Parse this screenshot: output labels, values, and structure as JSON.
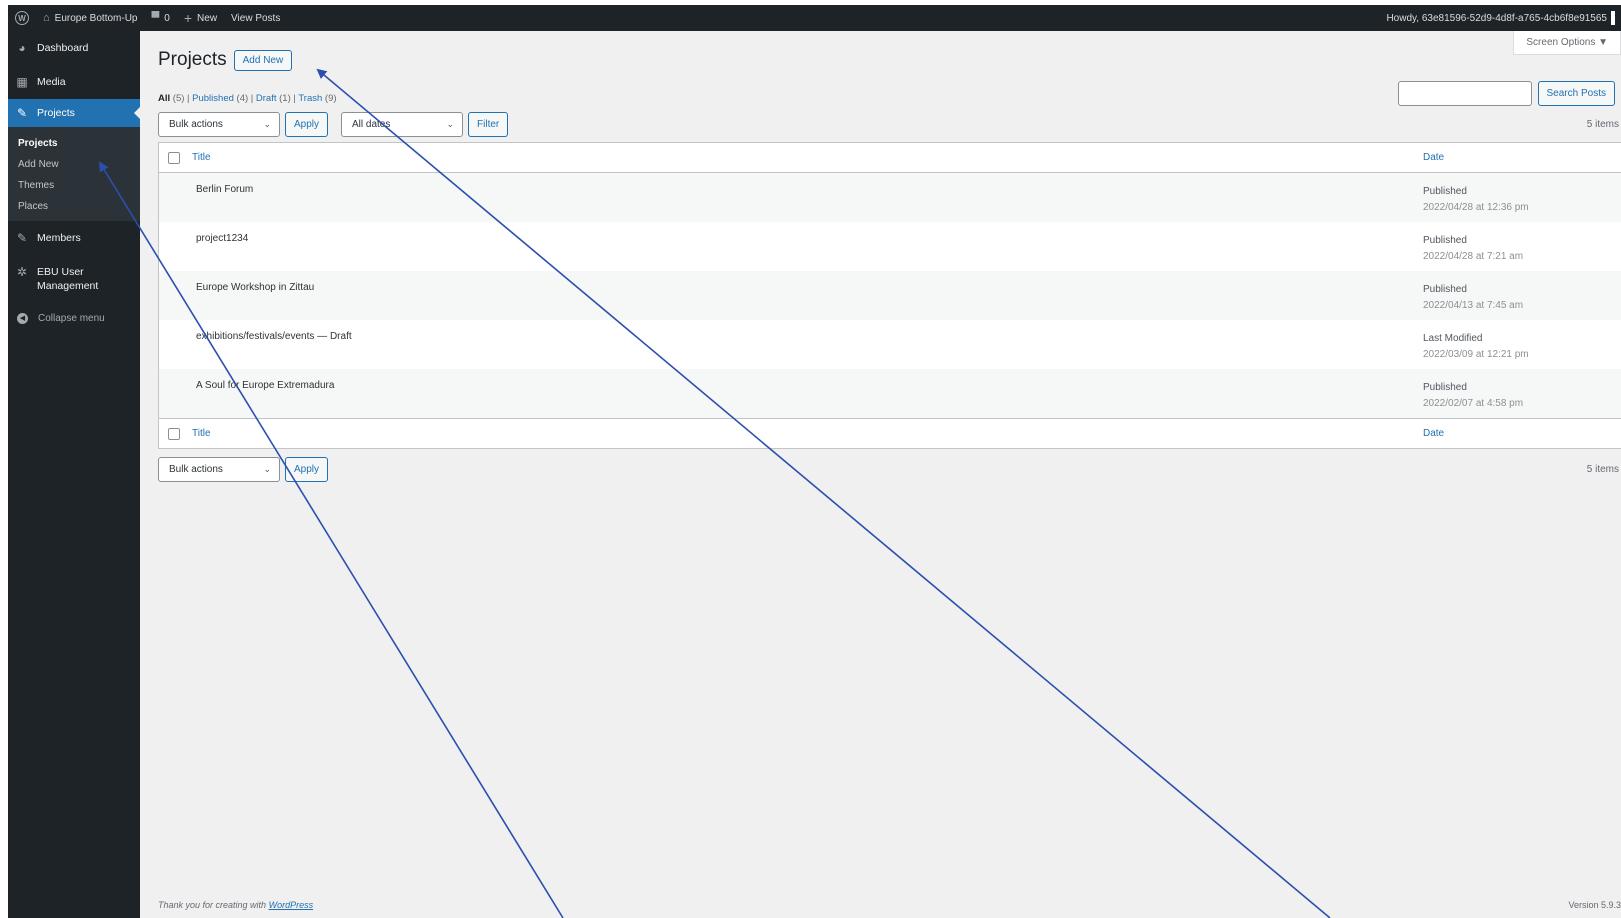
{
  "admin_bar": {
    "site_name": "Europe Bottom-Up",
    "comments_count": "0",
    "new_label": "New",
    "view_posts_label": "View Posts",
    "howdy_text": "Howdy, 63e81596-52d9-4d8f-a765-4cb6f8e91565"
  },
  "sidebar": {
    "dashboard": "Dashboard",
    "media": "Media",
    "projects": "Projects",
    "submenu": [
      "Projects",
      "Add New",
      "Themes",
      "Places"
    ],
    "members": "Members",
    "ebu_user_management": [
      "EBU User",
      "Management"
    ],
    "collapse": "Collapse menu"
  },
  "header": {
    "screen_options": "Screen Options ▼",
    "title": "Projects",
    "add_new": "Add New"
  },
  "views": {
    "all": "All",
    "all_count": "(5)",
    "published": "Published",
    "published_count": "(4)",
    "draft": "Draft",
    "draft_count": "(1)",
    "trash": "Trash",
    "trash_count": "(9)"
  },
  "search": {
    "button": "Search Posts"
  },
  "top_nav": {
    "bulk_actions": "Bulk actions",
    "apply": "Apply",
    "dates": "All dates",
    "filter": "Filter",
    "items": "5 items"
  },
  "table": {
    "col_title": "Title",
    "col_date": "Date",
    "rows": [
      {
        "title": "Berlin Forum",
        "status": "Published",
        "date": "2022/04/28 at 12:36 pm"
      },
      {
        "title": "project1234",
        "status": "Published",
        "date": "2022/04/28 at 7:21 am"
      },
      {
        "title": "Europe Workshop in Zittau",
        "status": "Published",
        "date": "2022/04/13 at 7:45 am"
      },
      {
        "title": "exhibitions/festivals/events — Draft",
        "status": "Last Modified",
        "date": "2022/03/09 at 12:21 pm"
      },
      {
        "title": "A Soul for Europe Extremadura",
        "status": "Published",
        "date": "2022/02/07 at 4:58 pm"
      }
    ]
  },
  "bottom_nav": {
    "bulk_actions": "Bulk actions",
    "apply": "Apply",
    "items": "5 items"
  },
  "footer": {
    "thanks_prefix": "Thank you for creating with",
    "wordpress": "WordPress",
    "version": "Version 5.9.3"
  },
  "colors": {
    "admin_dark": "#1d2327",
    "accent": "#2271b1",
    "annotation_arrow": "#2b4fae"
  }
}
